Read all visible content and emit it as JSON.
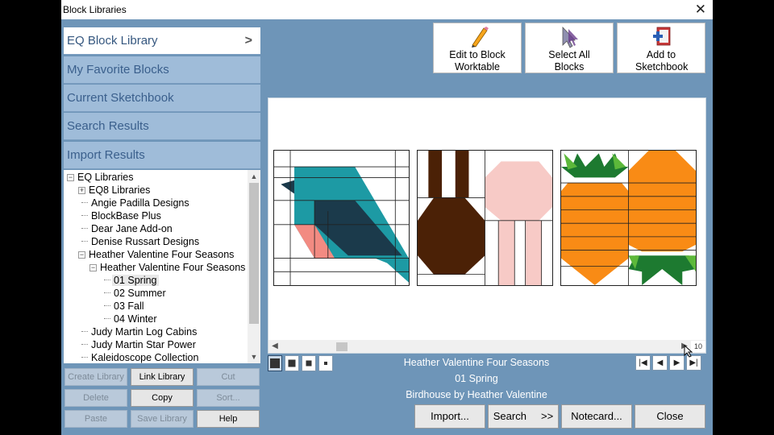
{
  "window": {
    "title": "Block Libraries"
  },
  "libraries": [
    {
      "label": "EQ Block Library",
      "active": true
    },
    {
      "label": "My Favorite Blocks"
    },
    {
      "label": "Current Sketchbook"
    },
    {
      "label": "Search Results"
    },
    {
      "label": "Import Results"
    }
  ],
  "tree": [
    {
      "label": "EQ Libraries",
      "toggle": "−"
    },
    {
      "label": "EQ8 Libraries",
      "toggle": "+"
    },
    {
      "label": "Angie Padilla Designs"
    },
    {
      "label": "BlockBase Plus"
    },
    {
      "label": "Dear Jane Add-on"
    },
    {
      "label": "Denise Russart Designs"
    },
    {
      "label": "Heather Valentine Four Seasons",
      "toggle": "−"
    },
    {
      "label": "Heather Valentine Four Seasons",
      "toggle": "−"
    },
    {
      "label": "01 Spring",
      "selected": true
    },
    {
      "label": "02 Summer"
    },
    {
      "label": "03 Fall"
    },
    {
      "label": "04 Winter"
    },
    {
      "label": "Judy Martin Log Cabins"
    },
    {
      "label": "Judy Martin Star Power"
    },
    {
      "label": "Kaleidoscope Collection"
    }
  ],
  "library_buttons": {
    "create": "Create Library",
    "link": "Link Library",
    "cut": "Cut",
    "delete": "Delete",
    "copy": "Copy",
    "sort": "Sort...",
    "paste": "Paste",
    "save": "Save Library",
    "help": "Help"
  },
  "toolbar": {
    "edit": "Edit to Block Worktable",
    "select_all": "Select All Blocks",
    "add": "Add to Sketchbook"
  },
  "scroll_count": "10",
  "info": {
    "library": "Heather Valentine Four Seasons",
    "section": "01 Spring",
    "block": "Birdhouse by Heather Valentine"
  },
  "actions": {
    "import": "Import...",
    "search": "Search",
    "search_arrow": ">>",
    "notecard": "Notecard...",
    "close": "Close"
  },
  "colors": {
    "window_bg": "#6e95b8",
    "teal": "#1d9aa4",
    "navy": "#1b3a4b",
    "salmon": "#f28b82",
    "brown": "#4b2106",
    "pink": "#f7cac6",
    "orange": "#f98b15",
    "green": "#1d7a30",
    "light_green": "#5cb83a"
  }
}
